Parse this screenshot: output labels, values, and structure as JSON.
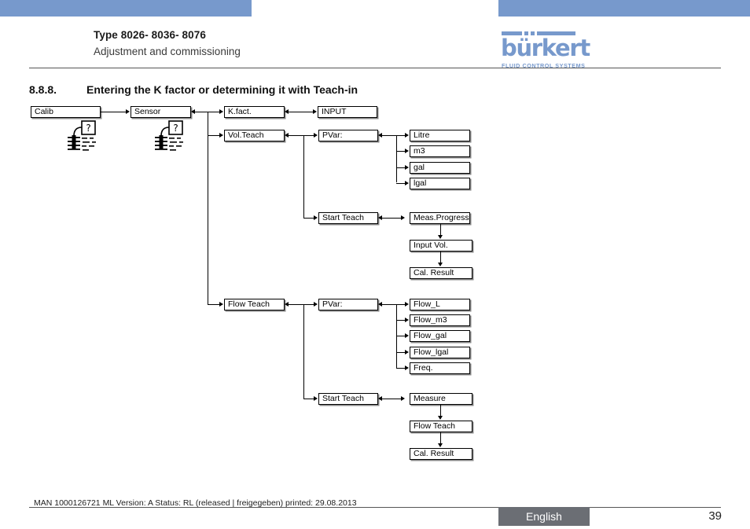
{
  "header": {
    "type_line": "Type 8026- 8036- 8076",
    "subtitle": "Adjustment and commissioning",
    "logo": {
      "wordmark": "bürkert",
      "tagline": "FLUID CONTROL SYSTEMS",
      "color": "#7799cc"
    }
  },
  "section": {
    "number": "8.8.8.",
    "title": "Entering the K factor or determining it with Teach-in"
  },
  "diagram": {
    "nodes": {
      "calib": "Calib",
      "sensor": "Sensor",
      "kfact": "K.fact.",
      "input": "INPUT",
      "vol_teach": "Vol.Teach",
      "pvar_vol": "PVar:",
      "litre": "Litre",
      "m3": "m3",
      "gal": "gal",
      "lgal": "lgal",
      "start_teach_vol": "Start Teach",
      "meas_progress": "Meas.Progress",
      "input_vol": "Input Vol.",
      "cal_result_vol": "Cal. Result",
      "flow_teach": "Flow Teach",
      "pvar_flow": "PVar:",
      "flow_l": "Flow_L",
      "flow_m3": "Flow_m3",
      "flow_gal": "Flow_gal",
      "flow_lgal": "Flow_lgal",
      "freq": "Freq.",
      "start_teach_flow": "Start Teach",
      "measure": "Measure",
      "flow_teach_step": "Flow Teach",
      "cal_result_flow": "Cal. Result"
    },
    "icons": {
      "sensor_probe_1": "sensor-probe-icon",
      "sensor_probe_2": "sensor-probe-icon",
      "question_mark": "?"
    }
  },
  "footer": {
    "meta": "MAN  1000126721  ML  Version: A Status: RL (released | freigegeben)  printed: 29.08.2013",
    "language": "English",
    "page": "39",
    "badge_color": "#6b6e74"
  }
}
